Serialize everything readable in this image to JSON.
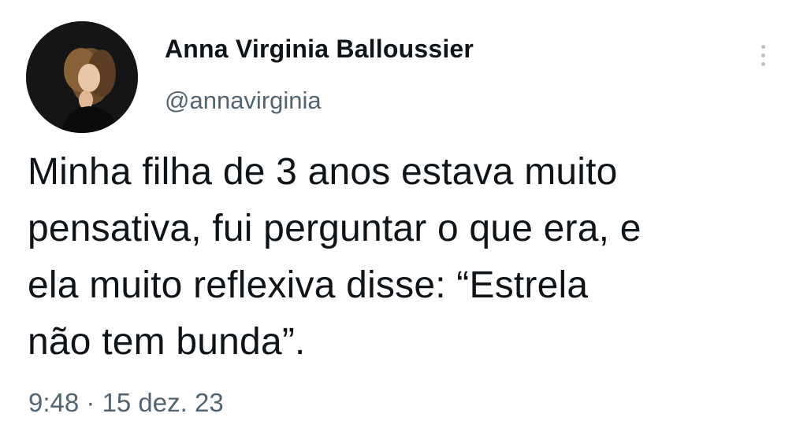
{
  "author": {
    "name": "Anna Virginia Balloussier",
    "handle": "@annavirginia",
    "avatar_icon": "profile-photo"
  },
  "more_icon": "vertical-ellipsis-icon",
  "tweet": {
    "lines": [
      "Minha filha de 3 anos estava muito",
      "pensativa, fui perguntar o que era, e",
      "ela muito reflexiva disse: “Estrela",
      "não tem bunda”."
    ]
  },
  "meta": {
    "time": "9:48",
    "separator": " · ",
    "date": "15 dez. 23"
  },
  "colors": {
    "text": "#0f1419",
    "secondary_text": "#536471",
    "more_icon": "#b9c0c6"
  }
}
